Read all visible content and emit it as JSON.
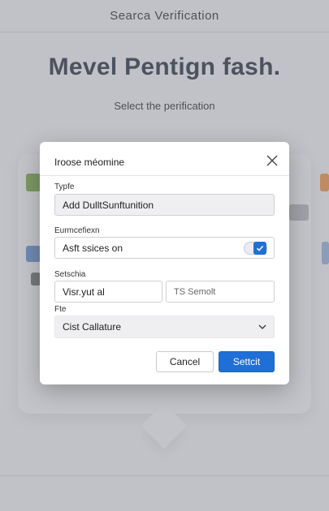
{
  "background": {
    "header_title": "Searca Verification",
    "hero_title": "Mevel Pentign fash.",
    "subtitle": "Select the perification"
  },
  "dialog": {
    "title": "Iroose méomine",
    "fields": {
      "type_label": "Typfe",
      "type_value": "Add DulltSunftunition",
      "toggle_label": "Eurmcefiexn",
      "toggle_text": "Asft ssices on",
      "toggle_on": true,
      "pair_label": "Setschia",
      "pair_left_value": "Visr.yut al",
      "pair_right_placeholder": "TS Semolt",
      "select_label": "Fte",
      "select_value": "Cist Callature"
    },
    "buttons": {
      "cancel": "Cancel",
      "submit": "Settcit"
    }
  },
  "colors": {
    "accent": "#1f6fd6",
    "title": "#2d3646"
  }
}
